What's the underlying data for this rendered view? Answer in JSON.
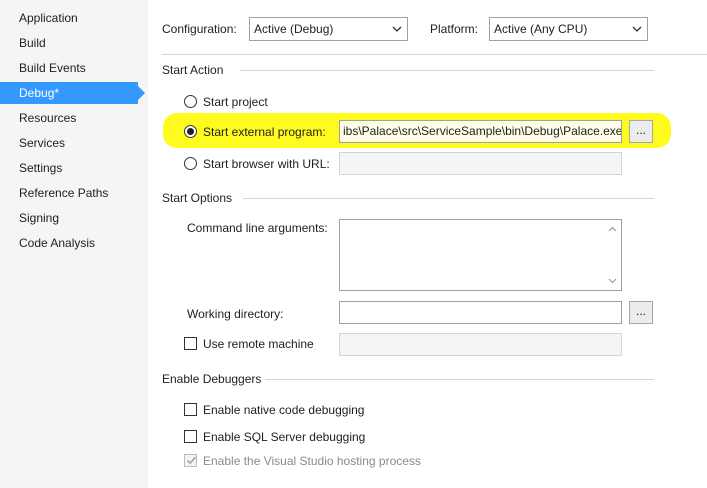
{
  "sidebar": {
    "items": [
      {
        "label": "Application"
      },
      {
        "label": "Build"
      },
      {
        "label": "Build Events"
      },
      {
        "label": "Debug*"
      },
      {
        "label": "Resources"
      },
      {
        "label": "Services"
      },
      {
        "label": "Settings"
      },
      {
        "label": "Reference Paths"
      },
      {
        "label": "Signing"
      },
      {
        "label": "Code Analysis"
      }
    ],
    "active_index": 3,
    "accent_color": "#3399ff"
  },
  "header": {
    "configuration_label": "Configuration:",
    "configuration_value": "Active (Debug)",
    "platform_label": "Platform:",
    "platform_value": "Active (Any CPU)"
  },
  "start_action": {
    "title": "Start Action",
    "start_project_label": "Start project",
    "start_external_label": "Start external program:",
    "start_external_value": "ibs\\Palace\\src\\ServiceSample\\bin\\Debug\\Palace.exe",
    "start_browser_label": "Start browser with URL:",
    "start_browser_value": "",
    "selected": "start_external",
    "browse_label": "...",
    "highlight_color": "#fffb1e"
  },
  "start_options": {
    "title": "Start Options",
    "command_line_label": "Command line arguments:",
    "command_line_value": "",
    "working_dir_label": "Working directory:",
    "working_dir_value": "",
    "browse_label": "...",
    "remote_label": "Use remote machine",
    "remote_checked": false,
    "remote_value": ""
  },
  "debuggers": {
    "title": "Enable Debuggers",
    "native_label": "Enable native code debugging",
    "native_checked": false,
    "sql_label": "Enable SQL Server debugging",
    "sql_checked": false,
    "hosting_label": "Enable the Visual Studio hosting process",
    "hosting_checked": true,
    "hosting_enabled": false
  }
}
